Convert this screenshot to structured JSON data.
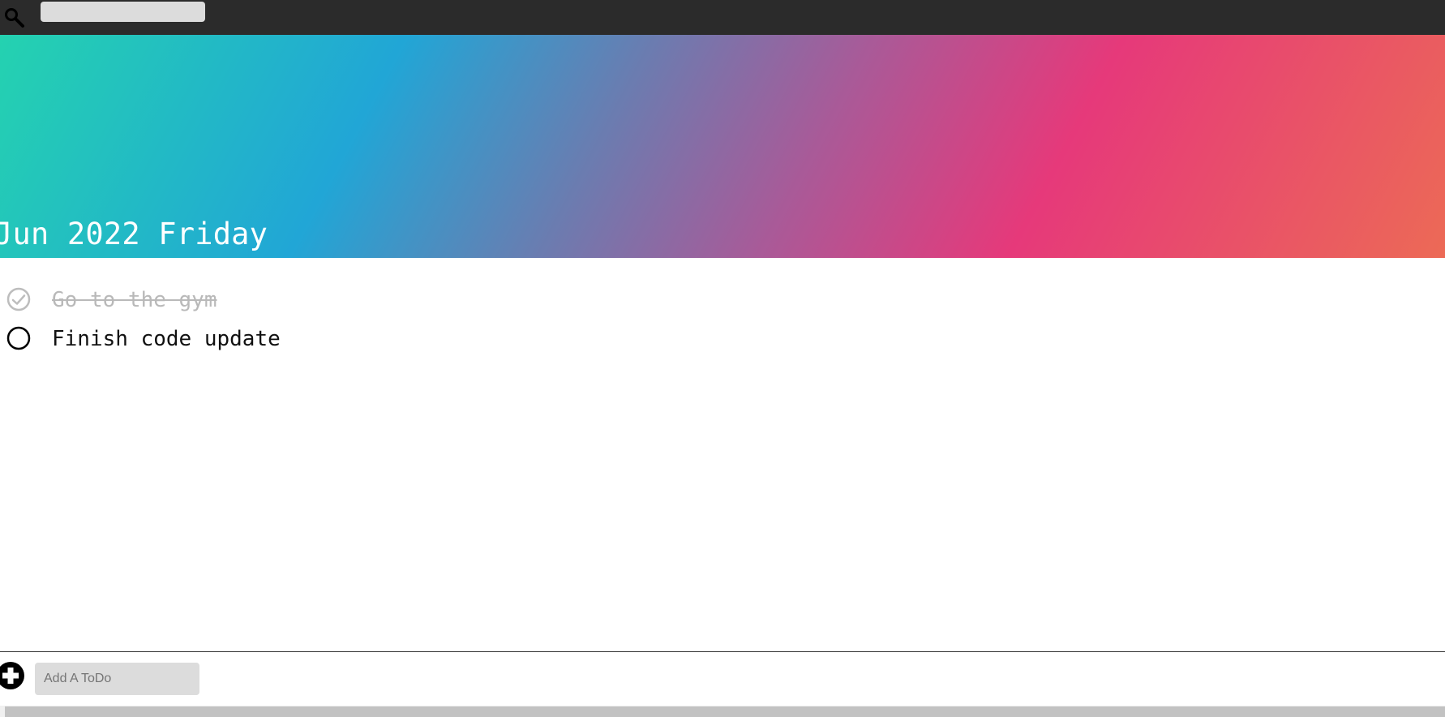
{
  "search": {
    "icon": "search-icon",
    "value": "",
    "placeholder": ""
  },
  "banner": {
    "date_text": "Jun 2022 Friday",
    "gradient_colors": [
      "#24d2b0",
      "#21a6d6",
      "#6b7cb0",
      "#a95a98",
      "#e6397a",
      "#ec6a56"
    ]
  },
  "todos": [
    {
      "text": "Go to the gym",
      "done": true,
      "icon": "check-circle-icon"
    },
    {
      "text": "Finish code update",
      "done": false,
      "icon": "empty-circle-icon"
    }
  ],
  "add_todo": {
    "icon": "plus-circle-icon",
    "value": "",
    "placeholder": "Add A ToDo"
  },
  "colors": {
    "topbar": "#2b2b2b",
    "done_text": "#b9b9b9",
    "input_bg": "#dcdcdc"
  }
}
